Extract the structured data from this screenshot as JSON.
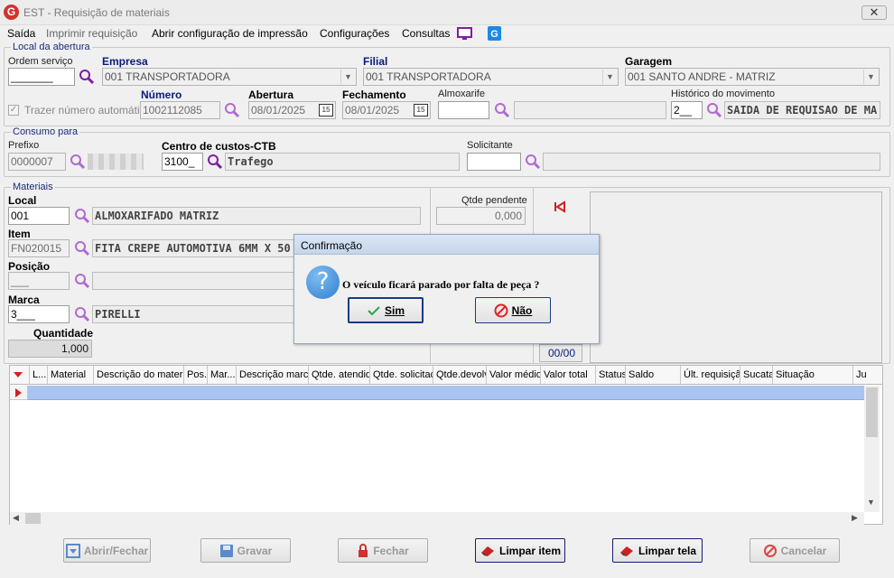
{
  "window": {
    "title": "EST - Requisição de materiais",
    "close_glyph": "✕",
    "logo_letter": "G"
  },
  "menu": {
    "items": [
      "Saída",
      "Imprimir requisição",
      "Abrir configuração de impressão",
      "Configurações",
      "Consultas"
    ]
  },
  "abertura": {
    "legend": "Local da abertura",
    "ordem_servico": {
      "label": "Ordem serviço",
      "value": "_______"
    },
    "empresa": {
      "label": "Empresa",
      "value": "001 TRANSPORTADORA"
    },
    "filial": {
      "label": "Filial",
      "value": "001 TRANSPORTADORA"
    },
    "garagem": {
      "label": "Garagem",
      "value": "001 SANTO ANDRE - MATRIZ"
    },
    "trazer_numero": {
      "label": "Trazer número automático",
      "checked": true
    },
    "numero": {
      "label": "Número",
      "value": "1002112085"
    },
    "abertura": {
      "label": "Abertura",
      "value": "08/01/2025"
    },
    "fechamento": {
      "label": "Fechamento",
      "value": "08/01/2025"
    },
    "almoxarife": {
      "label": "Almoxarife",
      "value": ""
    },
    "historico": {
      "label": "Histórico do movimento",
      "code": "2__",
      "desc": "SAIDA DE REQUISAO DE MA"
    },
    "cal_glyph": "15"
  },
  "consumo": {
    "legend": "Consumo para",
    "prefixo": {
      "label": "Prefixo",
      "value": "0000007"
    },
    "centro": {
      "label": "Centro de custos-CTB",
      "code": "3100_",
      "desc": "Trafego"
    },
    "solicitante": {
      "label": "Solicitante",
      "value": ""
    }
  },
  "materiais": {
    "legend": "Materiais",
    "local": {
      "label": "Local",
      "code": "001",
      "desc": "ALMOXARIFADO MATRIZ"
    },
    "item": {
      "label": "Item",
      "code": "FN020015",
      "desc": "FITA CREPE AUTOMOTIVA 6MM X 50"
    },
    "posicao": {
      "label": "Posição",
      "code": "___",
      "desc": ""
    },
    "marca": {
      "label": "Marca",
      "code": "3___",
      "desc": "PIRELLI"
    },
    "quantidade": {
      "label": "Quantidade",
      "value": "1,000"
    },
    "qtde_pendente": {
      "label": "Qtde pendente",
      "value": "0,000"
    },
    "counter": "00/00"
  },
  "grid": {
    "columns": [
      "L...",
      "Material",
      "Descrição do material",
      "Pos.",
      "Mar...",
      "Descrição marca",
      "Qtde. atendida",
      "Qtde. solicitada",
      "Qtde.devolv.",
      "Valor médio",
      "Valor total",
      "Status",
      "Saldo",
      "Últ. requisição",
      "Sucata",
      "Situação",
      "Ju"
    ]
  },
  "buttons": {
    "abrir": "Abrir/Fechar",
    "gravar": "Gravar",
    "fechar": "Fechar",
    "limpar_item": "Limpar item",
    "limpar_tela": "Limpar tela",
    "cancelar": "Cancelar"
  },
  "dialog": {
    "title": "Confirmação",
    "message": "O veículo ficará parado por falta de peça ?",
    "yes": "Sim",
    "no": "Não",
    "icon_glyph": "?"
  },
  "colors": {
    "accent": "#0a1a7a",
    "magnifier": "#8a2be2",
    "selected_row": "#a9c4f0",
    "dialog_icon": "#3c8fd6",
    "danger": "#cc2222"
  }
}
